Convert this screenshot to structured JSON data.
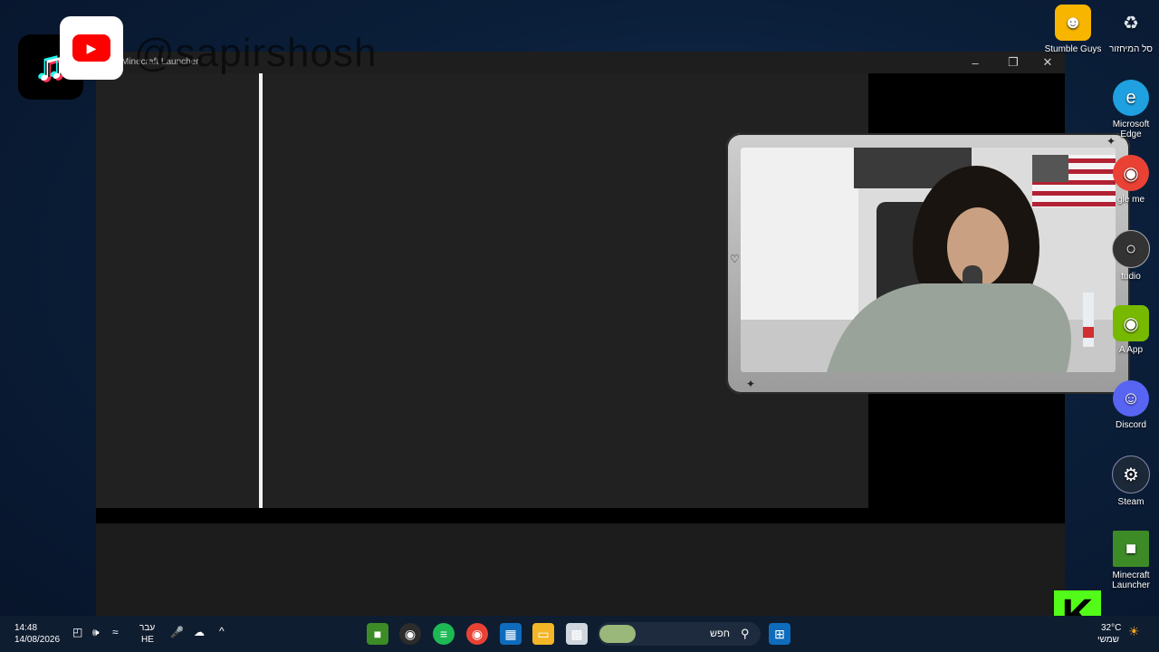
{
  "window": {
    "title": "Minecraft Launcher",
    "minimize_icon": "minimize-icon",
    "maximize_icon": "restore-icon",
    "close_icon": "close-icon"
  },
  "watermark": {
    "handle": "@sapirshosh",
    "tiktok_icon": "tiktok-icon",
    "youtube_icon": "youtube-icon"
  },
  "desktop_icons": [
    {
      "label": "Stumble Guys",
      "icon": "stumble-guys-icon",
      "color": "#f7b500"
    },
    {
      "label": "סל המיחזור",
      "icon": "recycle-bin-icon",
      "color": "#dfe8f3"
    },
    {
      "label": "Microsoft Edge",
      "icon": "edge-icon",
      "color": "#1fa0e0"
    },
    {
      "label": "gle me",
      "icon": "chrome-icon",
      "color": "#e94235"
    },
    {
      "label": "tudio",
      "icon": "studio-icon",
      "color": "#333333"
    },
    {
      "label": "A App",
      "icon": "nvidia-app-icon",
      "color": "#76b900"
    },
    {
      "label": "Discord",
      "icon": "discord-icon",
      "color": "#5865f2"
    },
    {
      "label": "Steam",
      "icon": "steam-icon",
      "color": "#1b2838"
    },
    {
      "label": "Minecraft Launcher",
      "icon": "minecraft-icon",
      "color": "#3c8b27"
    }
  ],
  "taskbar": {
    "time": "14:48",
    "date": "14/08/2026",
    "lang_top": "עבר",
    "lang_bottom": "HE",
    "search_placeholder": "חפש",
    "weather_temp": "32°C",
    "weather_label": "שמשי"
  },
  "kick_logo": "K"
}
